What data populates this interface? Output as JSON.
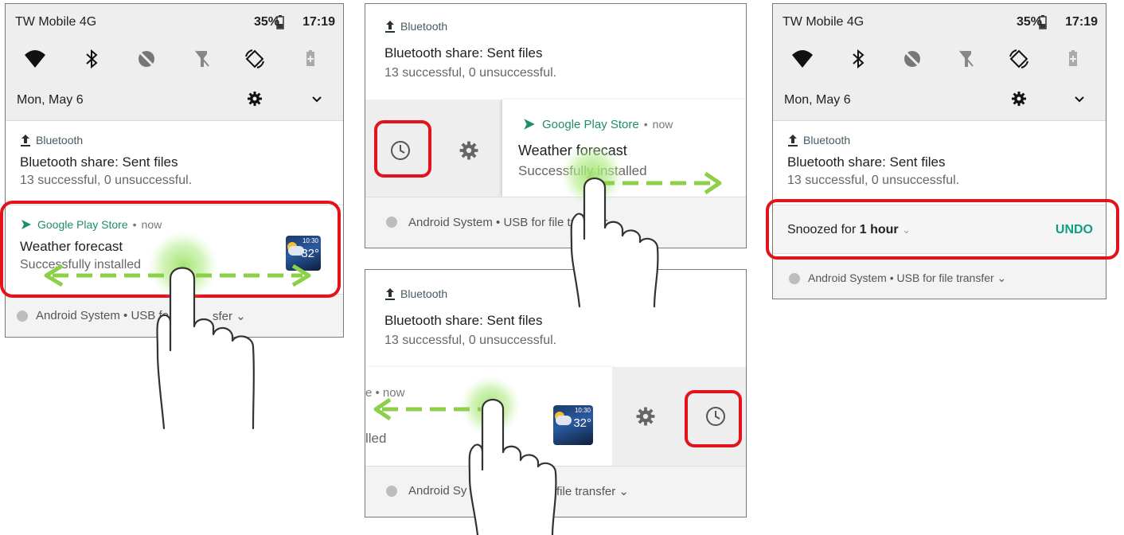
{
  "status": {
    "carrier": "TW Mobile 4G",
    "battery": "35%",
    "time": "17:19"
  },
  "quick_settings": [
    "wifi-icon",
    "bluetooth-icon",
    "dnd-icon",
    "flashlight-off-icon",
    "auto-rotate-icon",
    "battery-saver-icon"
  ],
  "date": "Mon, May 6",
  "bluetooth": {
    "app": "Bluetooth",
    "title": "Bluetooth share: Sent files",
    "text": "13 successful, 0 unsuccessful."
  },
  "playstore": {
    "app": "Google Play Store",
    "sep": "•",
    "time": "now",
    "title": "Weather forecast",
    "text": "Successfully installed",
    "text_fragment_a": "Successfully installed",
    "time_fragment": "e • now",
    "text_fragment_b": "lled"
  },
  "weather_thumb": {
    "clock": "10:30",
    "temp": "32°"
  },
  "footer": {
    "full": "Android System • USB for file transfer ⌄",
    "p1": "Android System • USB for file transfer ⌄",
    "p2a": "Android Sy",
    "p2b": "file transfer ⌄",
    "p1a": "Android System • USB for",
    "p1b": "sfer ⌄"
  },
  "snooze": {
    "label": "Snoozed for",
    "duration": "1 hour",
    "undo": "UNDO"
  },
  "colors": {
    "highlight": "#e2131b",
    "swipe_arrow": "#8cd04a",
    "accent_green": "#1e8f62",
    "undo_teal": "#0f9d84"
  }
}
